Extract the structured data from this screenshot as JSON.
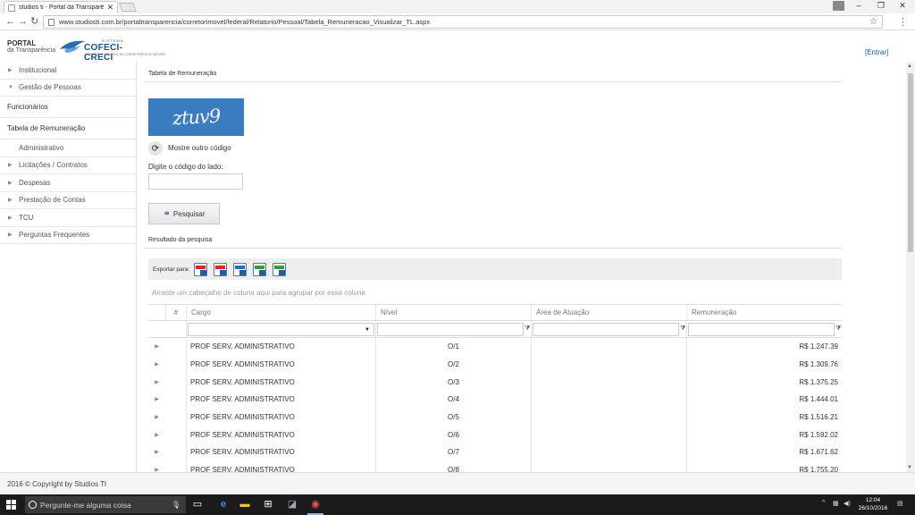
{
  "browser": {
    "tab_title": "studios ti - Portal da Transparência",
    "url": "www.studiosti.com.br/portaltransparencia/corretorimovel/federal/Relatorio/Pessoal/Tabela_Remuneracao_Visualizar_TL.aspx"
  },
  "header": {
    "portal_line1": "PORTAL",
    "portal_line2": "da Transparência",
    "logo_sistema": "SISTEMA",
    "logo_name": "COFECI-CRECI",
    "logo_sub": "CONSELHO FEDERAL DE CORRETORES DE IMÓVEIS",
    "login": "[Entrar]"
  },
  "sidebar": {
    "items": [
      {
        "label": "Institucional"
      },
      {
        "label": "Gestão de Pessoas"
      },
      {
        "label": "Funcionários"
      },
      {
        "label": "Tabela de Remuneração"
      },
      {
        "label": "Administrativo"
      },
      {
        "label": "Licitações / Contratos"
      },
      {
        "label": "Despesas"
      },
      {
        "label": "Prestação de Contas"
      },
      {
        "label": "TCU"
      },
      {
        "label": "Perguntas Frequentes"
      }
    ]
  },
  "main": {
    "title": "Tabela de Remuneração",
    "captcha_text": "ztuv9",
    "refresh_label": "Mostre outro código",
    "code_label": "Digite o código do lado:",
    "code_value": "",
    "search_label": "Pesquisar",
    "results_title": "Resultado da pesquisa",
    "export_label": "Exportar para:",
    "export_colors": [
      "#d62828",
      "#d62828",
      "#2b6cc4",
      "#3a9a3a",
      "#3a9a3a"
    ],
    "group_hint": "Arraste um cabeçalho de coluna aqui para agrupar por essa coluna",
    "columns": [
      "#",
      "Cargo",
      "Nível",
      "Área de Atuação",
      "Remuneração"
    ],
    "rows": [
      {
        "cargo": "PROF SERV. ADMINISTRATIVO",
        "nivel": "O/1",
        "area": "",
        "rem": "R$ 1.247.39"
      },
      {
        "cargo": "PROF SERV. ADMINISTRATIVO",
        "nivel": "O/2",
        "area": "",
        "rem": "R$ 1.309.76"
      },
      {
        "cargo": "PROF SERV. ADMINISTRATIVO",
        "nivel": "O/3",
        "area": "",
        "rem": "R$ 1.375.25"
      },
      {
        "cargo": "PROF SERV. ADMINISTRATIVO",
        "nivel": "O/4",
        "area": "",
        "rem": "R$ 1.444.01"
      },
      {
        "cargo": "PROF SERV. ADMINISTRATIVO",
        "nivel": "O/5",
        "area": "",
        "rem": "R$ 1.516.21"
      },
      {
        "cargo": "PROF SERV. ADMINISTRATIVO",
        "nivel": "O/6",
        "area": "",
        "rem": "R$ 1.592.02"
      },
      {
        "cargo": "PROF SERV. ADMINISTRATIVO",
        "nivel": "O/7",
        "area": "",
        "rem": "R$ 1.671.62"
      },
      {
        "cargo": "PROF SERV. ADMINISTRATIVO",
        "nivel": "O/8",
        "area": "",
        "rem": "R$ 1.755.20"
      }
    ]
  },
  "footer": {
    "copyright": "2016 © Copyright by Studios TI"
  },
  "taskbar": {
    "search_placeholder": "Pergunte-me alguma coisa",
    "time": "12:04",
    "date": "26/10/2016"
  }
}
